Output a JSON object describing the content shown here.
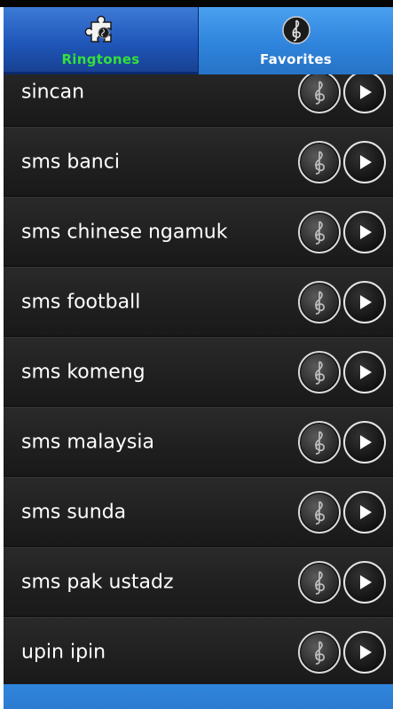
{
  "tabs": [
    {
      "label": "Ringtones",
      "icon": "puzzle-icon",
      "selected": true
    },
    {
      "label": "Favorites",
      "icon": "treble-clef-icon",
      "selected": false
    }
  ],
  "colors": {
    "accent_selected_label": "#35e13a",
    "tab_selected_bg": "#1f56b8",
    "tab_bg": "#2f84dc",
    "row_bg": "#1f1f1f"
  },
  "list": {
    "items": [
      {
        "label": "sincan"
      },
      {
        "label": "sms banci"
      },
      {
        "label": "sms chinese ngamuk"
      },
      {
        "label": "sms football"
      },
      {
        "label": "sms komeng"
      },
      {
        "label": "sms malaysia"
      },
      {
        "label": "sms sunda"
      },
      {
        "label": "sms pak ustadz"
      },
      {
        "label": "upin ipin"
      }
    ]
  }
}
